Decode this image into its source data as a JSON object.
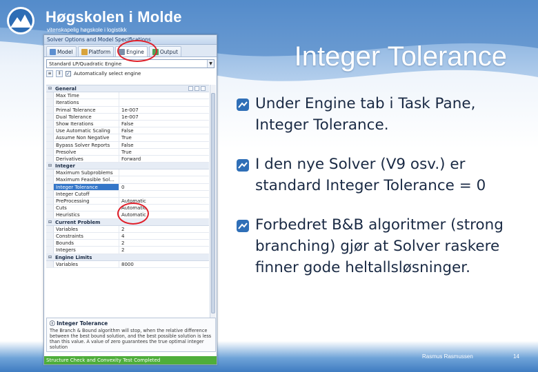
{
  "logo": {
    "name": "Høgskolen i Molde",
    "tagline": "vitenskapelig høgskole i logistikk"
  },
  "slide": {
    "title": "Integer Tolerance",
    "bullets": [
      "Under Engine tab i Task Pane, Integer Tolerance.",
      "I den nye Solver (V9 osv.) er standard Integer Tolerance = 0",
      "Forbedret B&B algoritmer (strong branching) gjør at Solver raskere finner gode heltallsløsninger."
    ],
    "author": "Rasmus Rasmussen",
    "page": "14"
  },
  "solver": {
    "window_title": "Solver Options and Model Specifications",
    "tabs": [
      {
        "label": "Model",
        "icon": "model-icon"
      },
      {
        "label": "Platform",
        "icon": "platform-icon"
      },
      {
        "label": "Engine",
        "icon": "engine-icon"
      },
      {
        "label": "Output",
        "icon": "output-icon"
      }
    ],
    "engine_selected": "Standard LP/Quadratic Engine",
    "auto_select_label": "Automatically select engine",
    "categories": [
      {
        "name": "General",
        "rows": [
          {
            "name": "Max Time",
            "value": ""
          },
          {
            "name": "Iterations",
            "value": ""
          },
          {
            "name": "Primal Tolerance",
            "value": "1e-007"
          },
          {
            "name": "Dual Tolerance",
            "value": "1e-007"
          },
          {
            "name": "Show Iterations",
            "value": "False"
          },
          {
            "name": "Use Automatic Scaling",
            "value": "False"
          },
          {
            "name": "Assume Non Negative",
            "value": "True"
          },
          {
            "name": "Bypass Solver Reports",
            "value": "False"
          },
          {
            "name": "Presolve",
            "value": "True"
          },
          {
            "name": "Derivatives",
            "value": "Forward"
          }
        ]
      },
      {
        "name": "Integer",
        "rows": [
          {
            "name": "Maximum Subproblems",
            "value": ""
          },
          {
            "name": "Maximum Feasible Sol...",
            "value": ""
          },
          {
            "name": "Integer Tolerance",
            "value": "0",
            "selected": true
          },
          {
            "name": "Integer Cutoff",
            "value": ""
          },
          {
            "name": "PreProcessing",
            "value": "Automatic"
          },
          {
            "name": "Cuts",
            "value": "Automatic"
          },
          {
            "name": "Heuristics",
            "value": "Automatic"
          }
        ]
      },
      {
        "name": "Current Problem",
        "rows": [
          {
            "name": "Variables",
            "value": "2"
          },
          {
            "name": "Constraints",
            "value": "4"
          },
          {
            "name": "Bounds",
            "value": "2"
          },
          {
            "name": "Integers",
            "value": "2"
          }
        ]
      },
      {
        "name": "Engine Limits",
        "rows": [
          {
            "name": "Variables",
            "value": "8000"
          }
        ]
      }
    ],
    "description_title": "Integer Tolerance",
    "description_text": "The Branch & Bound algorithm will stop, when the relative difference between the best bound solution, and the best possible solution is less than this value. A value of zero guarantees the true optimal integer solution",
    "status_text": "Structure Check and Convexity Test Completed"
  },
  "colors": {
    "accent": "#3476c8",
    "status_green": "#4fae3b",
    "highlight_red": "#e0202a",
    "title_white": "#ffffff"
  }
}
